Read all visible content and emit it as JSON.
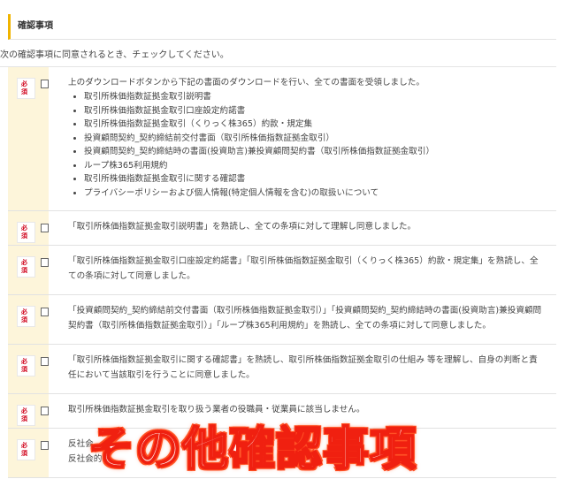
{
  "section": {
    "title": "確認事項",
    "intro": "次の確認事項に同意されるとき、チェックしてください。"
  },
  "badge": "必須",
  "items": [
    {
      "text": "上のダウンロードボタンから下記の書面のダウンロードを行い、全ての書面を受領しました。",
      "docs": [
        "取引所株価指数証拠金取引説明書",
        "取引所株価指数証拠金取引口座設定約諾書",
        "取引所株価指数証拠金取引（くりっく株365）約款・規定集",
        "投資顧問契約_契約締結前交付書面（取引所株価指数証拠金取引）",
        "投資顧問契約_契約締結時の書面(投資助言)兼投資顧問契約書（取引所株価指数証拠金取引）",
        "ループ株365利用規約",
        "取引所株価指数証拠金取引に関する確認書",
        "プライバシーポリシーおよび個人情報(特定個人情報を含む)の取扱いについて"
      ]
    },
    {
      "text": "「取引所株価指数証拠金取引説明書」を熟読し、全ての条項に対して理解し同意しました。"
    },
    {
      "text": "「取引所株価指数証拠金取引口座設定約諾書」「取引所株価指数証拠金取引（くりっく株365）約款・規定集」を熟読し、全ての条項に対して同意しました。"
    },
    {
      "text": "「投資顧問契約_契約締結前交付書面（取引所株価指数証拠金取引）」「投資顧問契約_契約締結時の書面(投資助言)兼投資顧問契約書（取引所株価指数証拠金取引）」「ループ株365利用規約」を熟読し、全ての条項に対して同意しました。"
    },
    {
      "text": "「取引所株価指数証拠金取引に関する確認書」を熟読し、取引所株価指数証拠金取引の仕組み 等を理解し、自身の判断と責任において当該取引を行うことに同意しました。"
    },
    {
      "text": "取引所株価指数証拠金取引を取り扱う業者の役職員・従業員に該当しません。"
    },
    {
      "text": "反社会",
      "text2": "反社会的"
    }
  ],
  "overlay": "その他確認事項"
}
